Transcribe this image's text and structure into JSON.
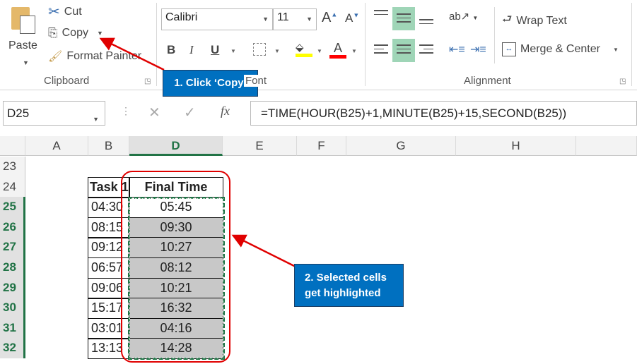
{
  "ribbon": {
    "clipboard": {
      "paste": "Paste",
      "cut": "Cut",
      "copy": "Copy",
      "format_painter": "Format Painter",
      "group": "Clipboard"
    },
    "font": {
      "name": "Calibri",
      "size": "11",
      "bold": "B",
      "italic": "I",
      "underline": "U",
      "group": "Font",
      "fill_color": "#ffff00",
      "font_color": "#ff0000"
    },
    "alignment": {
      "wrap_text": "Wrap Text",
      "merge_center": "Merge & Center",
      "group": "Alignment"
    }
  },
  "formula_bar": {
    "name_box": "D25",
    "fx": "fx",
    "formula": "=TIME(HOUR(B25)+1,MINUTE(B25)+15,SECOND(B25))"
  },
  "columns": [
    "A",
    "B",
    "D",
    "E",
    "F",
    "G",
    "H"
  ],
  "rows": [
    "23",
    "24",
    "25",
    "26",
    "27",
    "28",
    "29",
    "30",
    "31",
    "32"
  ],
  "table": {
    "headers": [
      "Task 1",
      "Final Time"
    ],
    "task1": [
      "04:30",
      "08:15",
      "09:12",
      "06:57",
      "09:06",
      "15:17",
      "03:01",
      "13:13"
    ],
    "final": [
      "05:45",
      "09:30",
      "10:27",
      "08:12",
      "10:21",
      "16:32",
      "04:16",
      "14:28"
    ]
  },
  "callouts": {
    "step1": "1. Click ‘Copy’",
    "step2_line1": "2. Selected cells",
    "step2_line2": "get highlighted"
  },
  "colors": {
    "accent": "#217346",
    "callout": "#0070c0",
    "annotation": "#e00000",
    "selection_fill": "#c8c8c8"
  }
}
